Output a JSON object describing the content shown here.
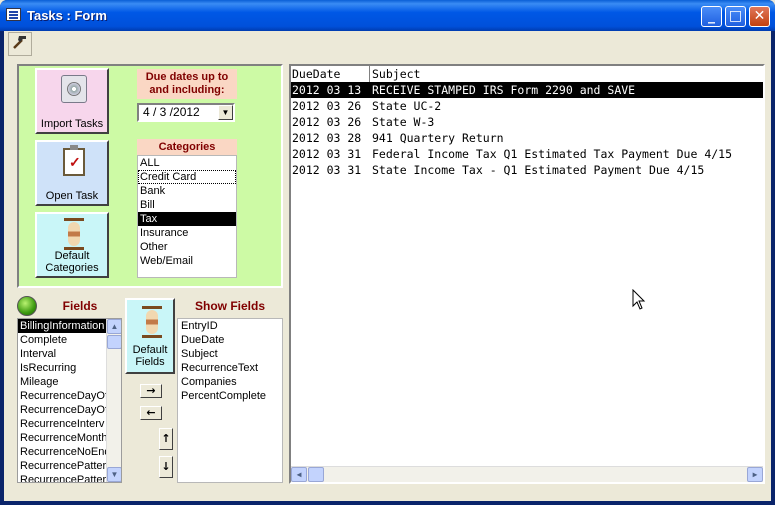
{
  "window": {
    "title": "Tasks : Form",
    "icon": "form-icon",
    "buttons": {
      "minimize": "_",
      "maximize": "□",
      "close": "✕"
    }
  },
  "toolbar": {
    "tool_icon": "hammer-icon"
  },
  "left_panel": {
    "import_label": "Import Tasks",
    "open_label": "Open Task",
    "default_categories_label": "Default Categories",
    "due_label": "Due dates up to and including:",
    "due_value": "4 / 3 /2012",
    "categories_header": "Categories",
    "categories": [
      "ALL",
      "Credit Card",
      "Bank",
      "Bill",
      "Tax",
      "Insurance",
      "Other",
      "Web/Email"
    ],
    "selected_category": "Tax",
    "focused_category": "Credit Card"
  },
  "fields_panel": {
    "fields_header": "Fields",
    "fields": [
      "BillingInformation",
      "Complete",
      "Interval",
      "IsRecurring",
      "Mileage",
      "RecurrenceDayOf",
      "RecurrenceDayOf",
      "RecurrenceInterv",
      "RecurrenceMonth",
      "RecurrenceNoEnd",
      "RecurrencePatter",
      "RecurrencePatter"
    ],
    "selected_field": "BillingInformation",
    "default_fields_label": "Default Fields",
    "show_header": "Show Fields",
    "show_fields": [
      "EntryID",
      "DueDate",
      "Subject",
      "RecurrenceText",
      "Companies",
      "PercentComplete"
    ],
    "arrows": {
      "add": "→",
      "remove": "←",
      "up": "↑",
      "down": "↓"
    }
  },
  "tasks_table": {
    "columns": [
      "DueDate",
      "Subject"
    ],
    "rows": [
      {
        "due": "2012 03 13",
        "subject": "RECEIVE STAMPED IRS Form 2290 and SAVE"
      },
      {
        "due": "2012 03 26",
        "subject": "State UC-2"
      },
      {
        "due": "2012 03 26",
        "subject": "State W-3"
      },
      {
        "due": "2012 03 28",
        "subject": "941 Quartery Return"
      },
      {
        "due": "2012 03 31",
        "subject": "Federal Income Tax Q1 Estimated Tax Payment Due 4/15"
      },
      {
        "due": "2012 03 31",
        "subject": "State Income Tax - Q1 Estimated Payment Due 4/15"
      }
    ],
    "selected_row": 0
  },
  "colors": {
    "title_bar": "#0054e3",
    "panel_green": "#cdfaa5",
    "header_peach": "#fad7c4",
    "header_text": "#800000",
    "selection": "#000000"
  }
}
